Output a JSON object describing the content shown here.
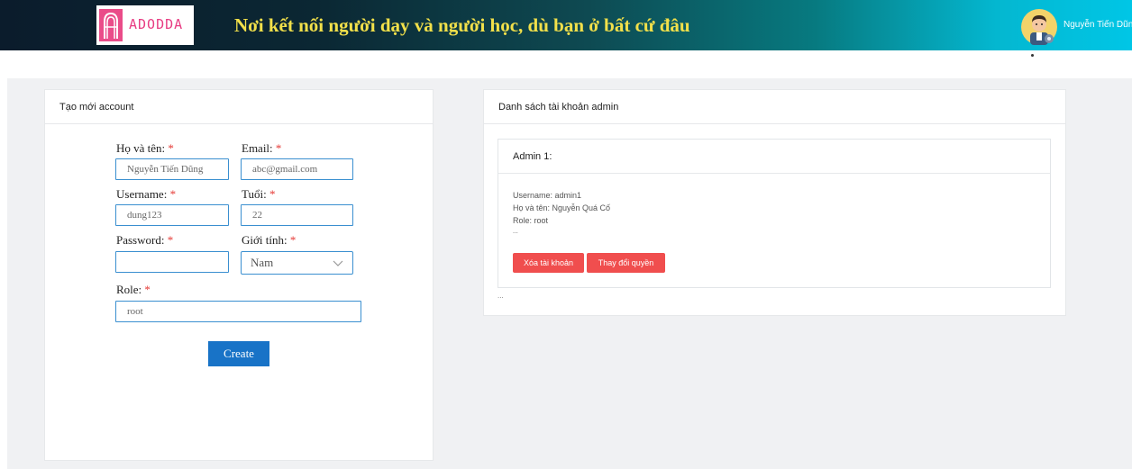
{
  "header": {
    "logo_text": "ADODDA",
    "tagline": "Nơi kết nối người dạy và người học, dù bạn ở bất cứ đâu",
    "user_name": "Nguyễn Tiến Dũng"
  },
  "create_form": {
    "title": "Tạo mới account",
    "fullname_label": "Họ và tên:",
    "fullname_value": "Nguyễn Tiến Dũng",
    "email_label": "Email:",
    "email_value": "abc@gmail.com",
    "username_label": "Username:",
    "username_value": "dung123",
    "age_label": "Tuổi:",
    "age_value": "22",
    "password_label": "Password:",
    "password_value": "",
    "gender_label": "Giới tính:",
    "gender_value": "Nam",
    "role_label": "Role:",
    "role_value": "root",
    "required_mark": "*",
    "create_label": "Create"
  },
  "admin_list": {
    "title": "Danh sách tài khoản admin",
    "admins": [
      {
        "heading": "Admin 1:",
        "username_line": "Username: admin1",
        "fullname_line": "Họ và tên: Nguyễn Quá Cố",
        "role_line": "Role: root",
        "more": "...",
        "delete_label": "Xóa tài khoản",
        "change_role_label": "Thay đổi quyền"
      }
    ],
    "more": "..."
  },
  "colors": {
    "primary": "#1873c7",
    "danger": "#f04e4e",
    "required": "#e53935",
    "tagline": "#f2e04a"
  }
}
